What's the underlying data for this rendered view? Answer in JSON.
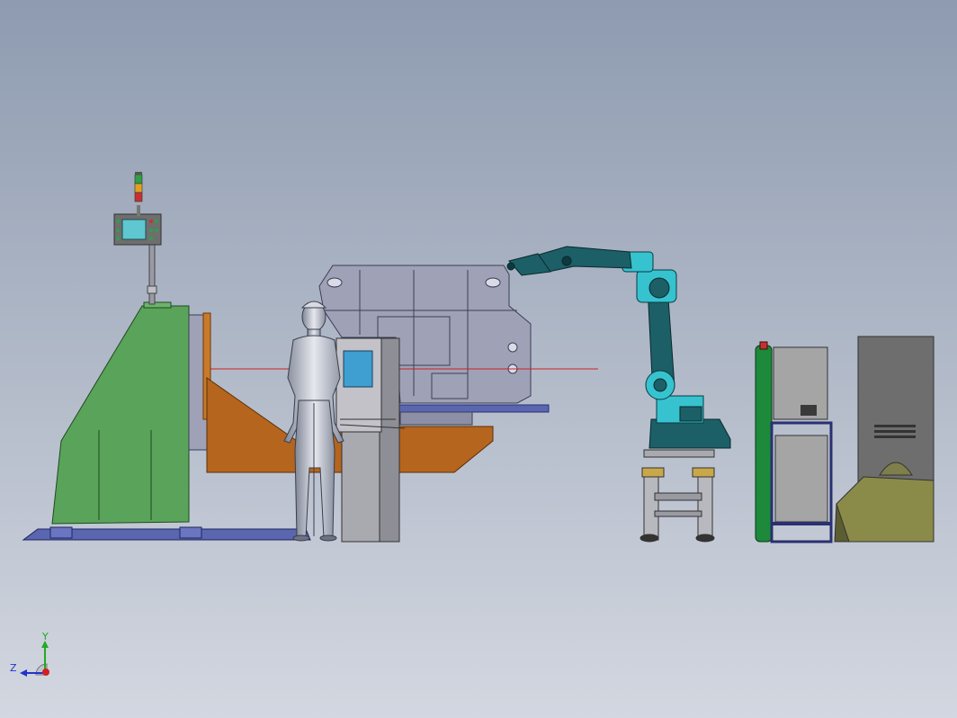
{
  "scene": {
    "colors": {
      "bg_top": "#8e9bb0",
      "bg_bottom": "#d3d7e0",
      "positioner_green": "#5aa35a",
      "positioner_brown": "#b5651d",
      "base_blue": "#5a66b0",
      "fixture_gray": "#9fa1b6",
      "robot_teal": "#1d5f66",
      "robot_cyan": "#36c3cf",
      "cylinder_green": "#1c8a3a",
      "cabinet_gray": "#a5a5a5",
      "cabinet_dark": "#6e6e6e",
      "olive": "#8a8b48",
      "laser_red": "#d02020"
    },
    "tower_light_colors": [
      "#2ea04a",
      "#e0a020",
      "#c83030"
    ]
  },
  "triad": {
    "y_label": "Y",
    "z_label": "Z",
    "y_color": "#22aa22",
    "z_color": "#2233cc",
    "x_color": "#d02020"
  }
}
